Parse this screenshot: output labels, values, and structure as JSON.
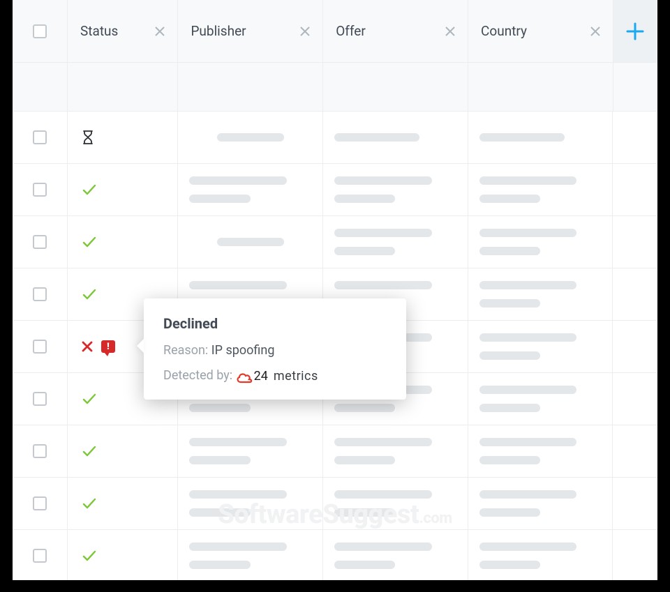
{
  "columns": {
    "status": "Status",
    "publisher": "Publisher",
    "offer": "Offer",
    "country": "Country"
  },
  "tooltip": {
    "title": "Declined",
    "reason_label": "Reason:",
    "reason_value": "IP spoofing",
    "detected_label": "Detected by:",
    "detected_by_brand_prefix": "24",
    "detected_by_brand_word": "metrics"
  },
  "icons": {
    "close": "close-icon",
    "plus": "plus-icon",
    "checkbox": "checkbox",
    "check": "check-icon",
    "hourglass": "hourglass-icon",
    "x_red": "x-red-icon",
    "chat_alert": "chat-alert-icon"
  },
  "rows": [
    {
      "status": "pending"
    },
    {
      "status": "ok"
    },
    {
      "status": "ok"
    },
    {
      "status": "ok"
    },
    {
      "status": "declined"
    },
    {
      "status": "ok"
    },
    {
      "status": "ok"
    },
    {
      "status": "ok"
    },
    {
      "status": "ok"
    }
  ],
  "watermark": {
    "name": "SoftwareSuggest",
    "tld": ".com"
  }
}
